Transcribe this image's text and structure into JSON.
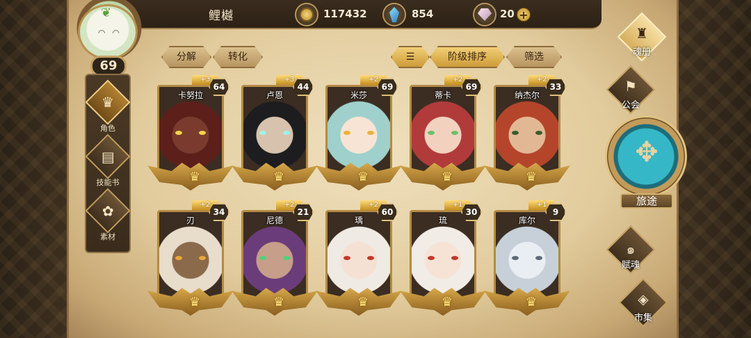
{
  "player": {
    "name": "鲤樾",
    "level": "69"
  },
  "resources": [
    {
      "name": "gold-coin",
      "value": "117432"
    },
    {
      "name": "blue-crystal",
      "value": "854"
    },
    {
      "name": "pink-gem",
      "value": "20"
    }
  ],
  "toolbar": {
    "decompose": "分解",
    "convert": "转化",
    "sort": "阶级排序",
    "filter": "筛选"
  },
  "left_nav": [
    {
      "label": "角色",
      "icon": "helmet-icon"
    },
    {
      "label": "技能书",
      "icon": "book-icon"
    },
    {
      "label": "素材",
      "icon": "material-icon"
    }
  ],
  "right_nav": {
    "soul": "魂册",
    "guild": "公会",
    "journey": "旅途",
    "talent": "赋魂",
    "market": "市集"
  },
  "heroes": [
    {
      "name": "卡努拉",
      "level": "64",
      "plus": "+3",
      "skin": "#7a3b2e",
      "hair": "#5c1f1a",
      "eye": "#f7d24a"
    },
    {
      "name": "卢恩",
      "level": "44",
      "plus": "+3",
      "skin": "#d7c3ad",
      "hair": "#1d1d1f",
      "eye": "#9ef2e8"
    },
    {
      "name": "米莎",
      "level": "69",
      "plus": "+2",
      "skin": "#f8e4d4",
      "hair": "#9fd0cc",
      "eye": "#e7b23a"
    },
    {
      "name": "蒂卡",
      "level": "69",
      "plus": "+2",
      "skin": "#f2d2bf",
      "hair": "#b13b3b",
      "eye": "#6bbf6b"
    },
    {
      "name": "纳杰尔",
      "level": "33",
      "plus": "+2",
      "skin": "#e2b894",
      "hair": "#b4452a",
      "eye": "#3b5a2a"
    },
    {
      "name": "刃",
      "level": "34",
      "plus": "+2",
      "skin": "#8b6a4c",
      "hair": "#e8dccb",
      "eye": "#e7a83a"
    },
    {
      "name": "尼德",
      "level": "21",
      "plus": "+2",
      "skin": "#c79e8a",
      "hair": "#6b3c7a",
      "eye": "#4fd27a"
    },
    {
      "name": "瑀",
      "level": "60",
      "plus": "+2",
      "skin": "#f5e1d4",
      "hair": "#efeae4",
      "eye": "#c0392b"
    },
    {
      "name": "琉",
      "level": "30",
      "plus": "+1",
      "skin": "#f7e3d6",
      "hair": "#f2ece6",
      "eye": "#c0392b"
    },
    {
      "name": "库尔",
      "level": "9",
      "plus": "+1",
      "skin": "#e9eef2",
      "hair": "#c7d0d8",
      "eye": "#5e6b7a"
    }
  ]
}
